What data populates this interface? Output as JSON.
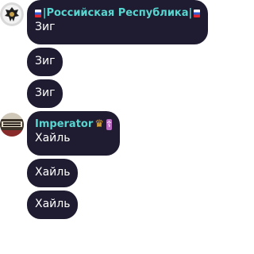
{
  "messages": [
    {
      "sender": {
        "name": "|Российская Республика|",
        "badges": [
          "russia-flag-icon",
          "russia-flag-icon"
        ],
        "color": "#58d6d0"
      },
      "text": "Зиг",
      "avatar": "eagle-emblem-icon"
    },
    {
      "text": "Зиг"
    },
    {
      "text": "Зиг"
    },
    {
      "sender": {
        "name": "Imperator",
        "badges": [
          "crown-icon",
          "orthodox-cross-icon"
        ],
        "color": "#58d6d0"
      },
      "text": "Хайль",
      "avatar": "imperator-avatar-icon"
    },
    {
      "text": "Хайль"
    },
    {
      "text": "Хайль"
    }
  ],
  "colors": {
    "bubble": "#1f1b31",
    "text": "#ffffff",
    "background": "#ffffff",
    "flag_white": "#ffffff",
    "flag_blue": "#2f5bd6",
    "flag_red": "#e3262d",
    "crown": "#f3b632",
    "cross_badge": "#b86ac3"
  }
}
